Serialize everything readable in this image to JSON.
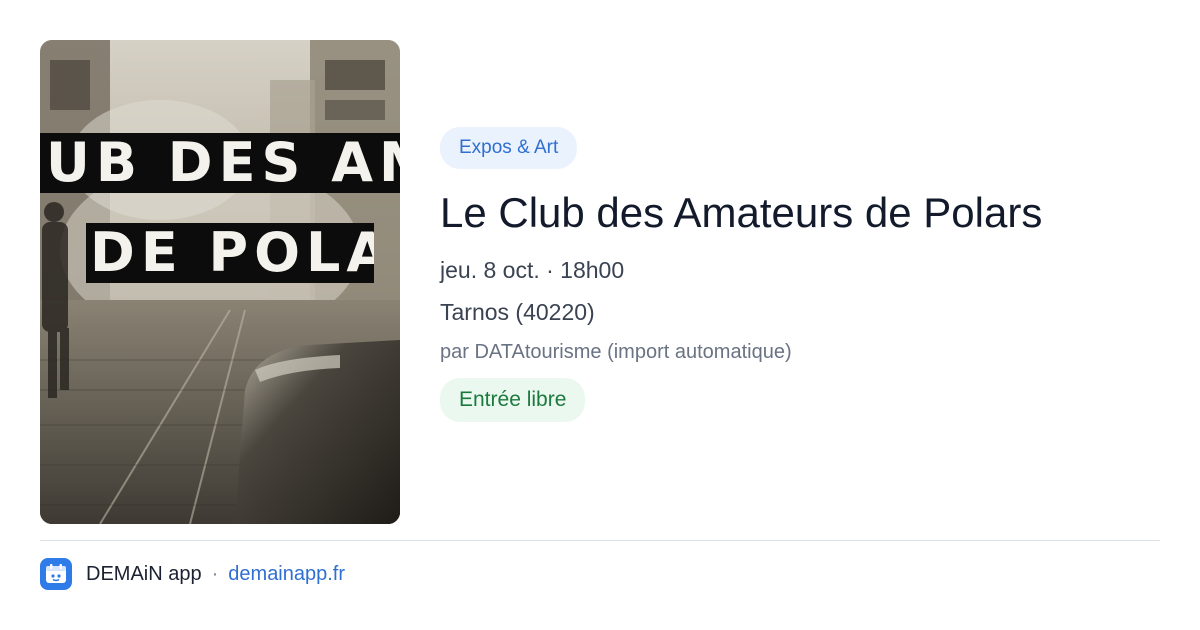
{
  "poster": {
    "title_line1": "UB DES AMAT",
    "title_line2": "DE POLARS"
  },
  "event": {
    "category": "Expos & Art",
    "title": "Le Club des Amateurs de Polars",
    "date_time": "jeu. 8 oct. · 18h00",
    "location": "Tarnos (40220)",
    "source": "par DATAtourisme (import automatique)",
    "price": "Entrée libre"
  },
  "footer": {
    "app_name": "DEMAiN app",
    "separator": "·",
    "site": "demainapp.fr"
  },
  "colors": {
    "accent": "#2f6fd1",
    "category_bg": "#eaf2fd",
    "price_bg": "#eaf8ef",
    "price_text": "#1d7a3e",
    "logo_bg": "#2f7be8"
  }
}
